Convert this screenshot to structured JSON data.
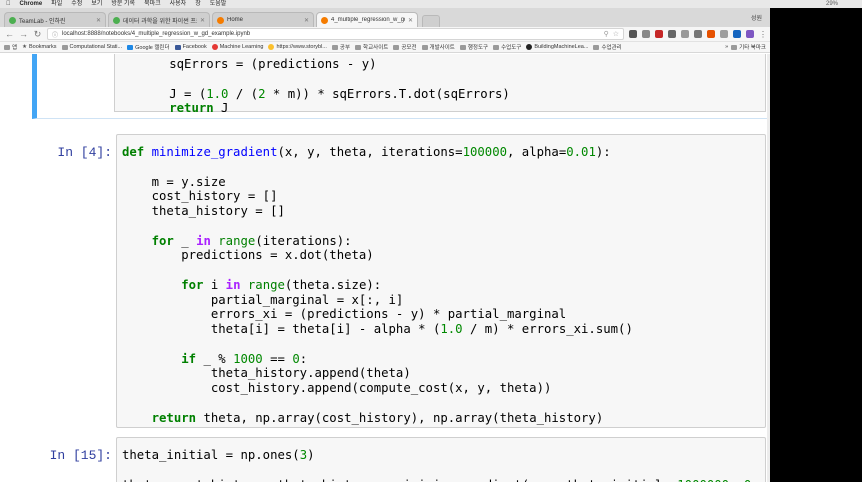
{
  "menubar": {
    "app": "Chrome",
    "items": [
      "파일",
      "수정",
      "보기",
      "방문 기록",
      "북마크",
      "사용자",
      "창",
      "도움말"
    ],
    "right_text": "29%"
  },
  "tabs": [
    {
      "title": "TeamLab - 인하린",
      "color": "#4caf50",
      "active": false
    },
    {
      "title": "데이터 과학을 위한 파이썬 프로그래...",
      "color": "#4caf50",
      "active": false
    },
    {
      "title": "Home",
      "color": "#f57c00",
      "active": false
    },
    {
      "title": "4_multiple_regression_w_gd_ex...",
      "color": "#f57c00",
      "active": true
    }
  ],
  "profile": "성원",
  "toolbar": {
    "url": "localhost:8888/notebooks/4_multiple_regression_w_gd_example.ipynb"
  },
  "bookmarks": {
    "apps": "앱",
    "items": [
      "Bookmarks",
      "Computational Stati...",
      "Google 캘린더",
      "Facebook",
      "Machine Learning",
      "https://www.storybl...",
      "공부",
      "학교사이트",
      "공모전",
      "개발사이트",
      "행정도구",
      "수업도구",
      "BuildingMachineLea...",
      "수업관리"
    ],
    "overflow": "»",
    "other": "기타 북마크"
  },
  "cells": {
    "prev": {
      "lines": [
        [
          {
            "t": "        sqErrors = (predictions - y)",
            "c": ""
          }
        ],
        [
          {
            "t": "",
            "c": ""
          }
        ],
        [
          {
            "t": "        J = (",
            "c": ""
          },
          {
            "t": "1.0",
            "c": "num"
          },
          {
            "t": " / (",
            "c": ""
          },
          {
            "t": "2",
            "c": "num"
          },
          {
            "t": " * m)) * sqErrors.T.dot(sqErrors)",
            "c": ""
          }
        ],
        [
          {
            "t": "        ",
            "c": ""
          },
          {
            "t": "return",
            "c": "kw"
          },
          {
            "t": " J",
            "c": ""
          }
        ]
      ]
    },
    "cell4": {
      "prompt": "In [4]:",
      "lines": [
        [
          {
            "t": "def",
            "c": "kw"
          },
          {
            "t": " ",
            "c": ""
          },
          {
            "t": "minimize_gradient",
            "c": "fn"
          },
          {
            "t": "(x, y, theta, iterations=",
            "c": ""
          },
          {
            "t": "100000",
            "c": "num"
          },
          {
            "t": ", alpha=",
            "c": ""
          },
          {
            "t": "0.01",
            "c": "num"
          },
          {
            "t": "):",
            "c": ""
          }
        ],
        [
          {
            "t": "",
            "c": ""
          }
        ],
        [
          {
            "t": "    m = y.size",
            "c": ""
          }
        ],
        [
          {
            "t": "    cost_history = []",
            "c": ""
          }
        ],
        [
          {
            "t": "    theta_history = []",
            "c": ""
          }
        ],
        [
          {
            "t": "",
            "c": ""
          }
        ],
        [
          {
            "t": "    ",
            "c": ""
          },
          {
            "t": "for",
            "c": "kw"
          },
          {
            "t": " _ ",
            "c": ""
          },
          {
            "t": "in",
            "c": "op"
          },
          {
            "t": " ",
            "c": ""
          },
          {
            "t": "range",
            "c": "bi"
          },
          {
            "t": "(iterations):",
            "c": ""
          }
        ],
        [
          {
            "t": "        predictions = x.dot(theta)",
            "c": ""
          }
        ],
        [
          {
            "t": "",
            "c": ""
          }
        ],
        [
          {
            "t": "        ",
            "c": ""
          },
          {
            "t": "for",
            "c": "kw"
          },
          {
            "t": " i ",
            "c": ""
          },
          {
            "t": "in",
            "c": "op"
          },
          {
            "t": " ",
            "c": ""
          },
          {
            "t": "range",
            "c": "bi"
          },
          {
            "t": "(theta.size):",
            "c": ""
          }
        ],
        [
          {
            "t": "            partial_marginal = x[:, i]",
            "c": ""
          }
        ],
        [
          {
            "t": "            errors_xi = (predictions - y) * partial_marginal",
            "c": ""
          }
        ],
        [
          {
            "t": "            theta[i] = theta[i] - alpha * (",
            "c": ""
          },
          {
            "t": "1.0",
            "c": "num"
          },
          {
            "t": " / m) * errors_xi.sum()",
            "c": ""
          }
        ],
        [
          {
            "t": "",
            "c": ""
          }
        ],
        [
          {
            "t": "        ",
            "c": ""
          },
          {
            "t": "if",
            "c": "kw"
          },
          {
            "t": " _ % ",
            "c": ""
          },
          {
            "t": "1000",
            "c": "num"
          },
          {
            "t": " == ",
            "c": ""
          },
          {
            "t": "0",
            "c": "num"
          },
          {
            "t": ":",
            "c": ""
          }
        ],
        [
          {
            "t": "            theta_history.append(theta)",
            "c": ""
          }
        ],
        [
          {
            "t": "            cost_history.append(compute_cost(x, y, theta))",
            "c": ""
          }
        ],
        [
          {
            "t": "",
            "c": ""
          }
        ],
        [
          {
            "t": "    ",
            "c": ""
          },
          {
            "t": "return",
            "c": "kw"
          },
          {
            "t": " theta, np.array(cost_history), np.array(theta_history)",
            "c": ""
          }
        ]
      ]
    },
    "cell15": {
      "prompt": "In [15]:",
      "lines": [
        [
          {
            "t": "theta_initial = np.ones(",
            "c": ""
          },
          {
            "t": "3",
            "c": "num"
          },
          {
            "t": ")",
            "c": ""
          }
        ],
        [
          {
            "t": "",
            "c": ""
          }
        ],
        [
          {
            "t": "theta, cost_history, theta_history = minimize_gradient(x, y,theta_initial, ",
            "c": ""
          },
          {
            "t": "1000000",
            "c": "num"
          },
          {
            "t": ", ",
            "c": ""
          },
          {
            "t": "0",
            "c": "num"
          }
        ]
      ]
    }
  }
}
